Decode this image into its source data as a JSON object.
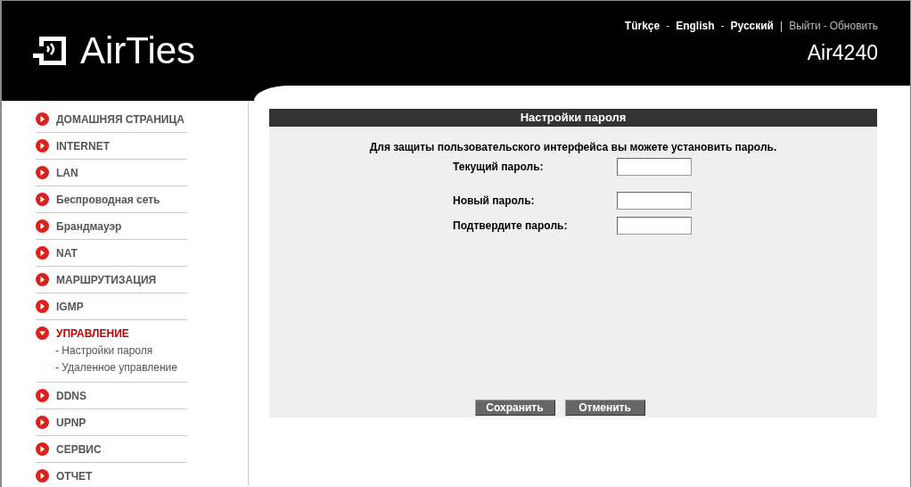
{
  "header": {
    "logo": "AirTies",
    "languages": [
      {
        "label": "Türkçe"
      },
      {
        "label": "English"
      },
      {
        "label": "Русский"
      }
    ],
    "separator": "-",
    "divider": "|",
    "logout": "Выйти",
    "refresh": "Обновить",
    "link_separator": "-",
    "model": "Air4240"
  },
  "sidebar": {
    "items": [
      {
        "label": "ДОМАШНЯЯ СТРАНИЦА",
        "expanded": false
      },
      {
        "label": "INTERNET",
        "expanded": false
      },
      {
        "label": "LAN",
        "expanded": false
      },
      {
        "label": "Беспроводная сеть",
        "expanded": false
      },
      {
        "label": "Брандмауэр",
        "expanded": false
      },
      {
        "label": "NAT",
        "expanded": false
      },
      {
        "label": "МАРШРУТИЗАЦИЯ",
        "expanded": false
      },
      {
        "label": "IGMP",
        "expanded": false
      },
      {
        "label": "УПРАВЛЕНИЕ",
        "expanded": true,
        "children": [
          {
            "marker": "-",
            "label": "Настройки пароля"
          },
          {
            "marker": "-",
            "label": "Удаленное управление"
          }
        ]
      },
      {
        "label": "DDNS",
        "expanded": false
      },
      {
        "label": "UPNP",
        "expanded": false
      },
      {
        "label": "СЕРВИС",
        "expanded": false
      },
      {
        "label": "ОТЧЕТ",
        "expanded": false
      }
    ]
  },
  "panel": {
    "title": "Настройки пароля",
    "intro": "Для защиты пользовательского интерфейса вы можете установить пароль.",
    "fields": [
      {
        "label": "Текущий пароль:"
      },
      {
        "label": "Новый пароль:"
      },
      {
        "label": "Подтвердите пароль:"
      }
    ],
    "buttons": [
      "Сохранить",
      "Отменить"
    ]
  }
}
